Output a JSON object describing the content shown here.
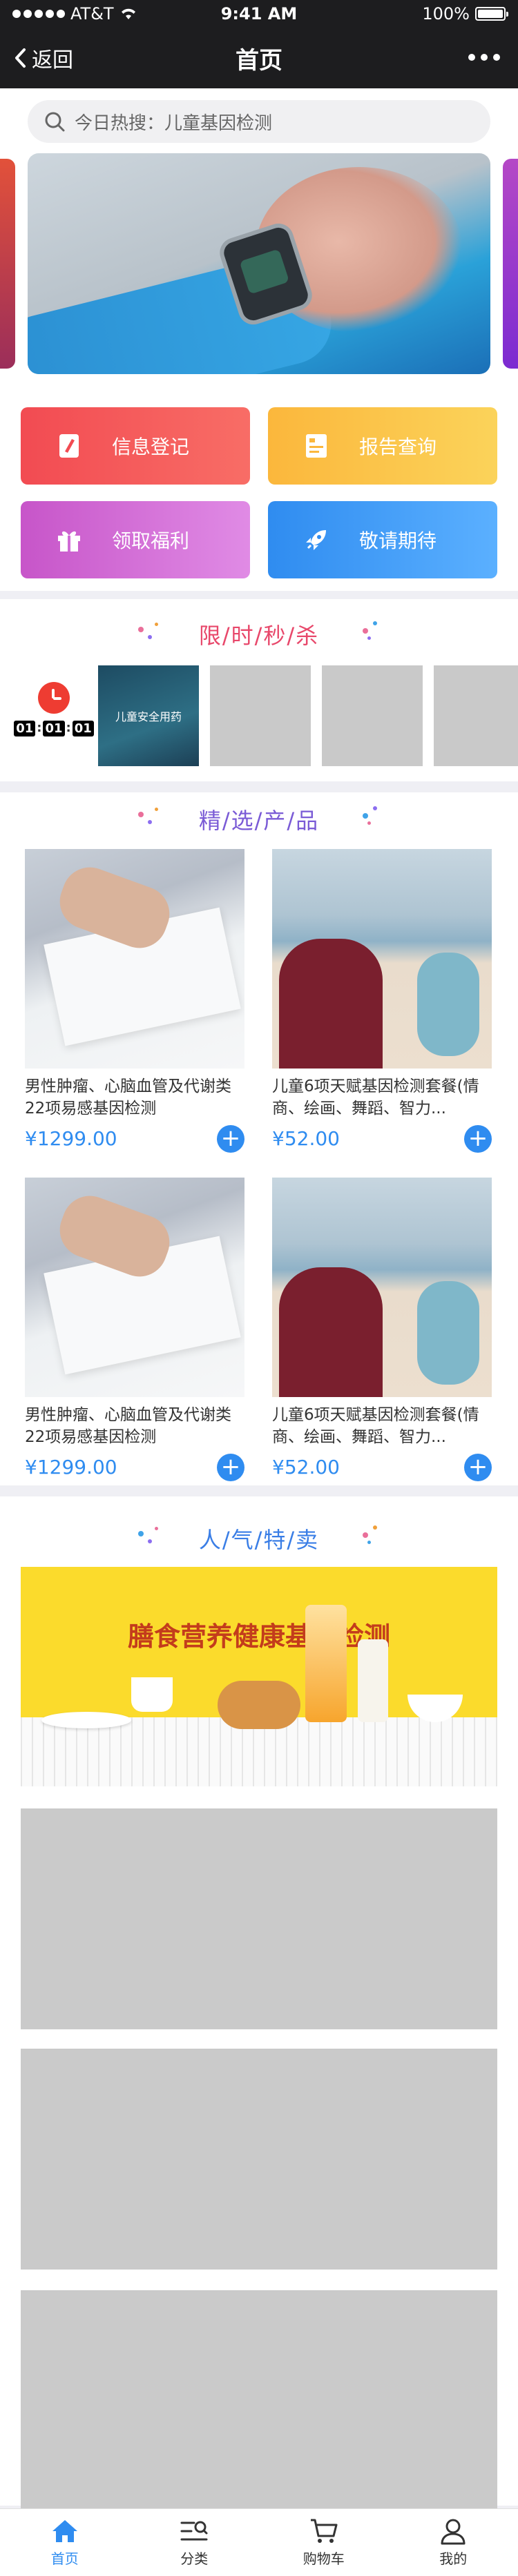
{
  "status_bar": {
    "carrier": "AT&T",
    "time": "9:41 AM",
    "battery": "100%"
  },
  "nav": {
    "back_label": "返回",
    "title": "首页"
  },
  "search": {
    "placeholder": "今日热搜：儿童基因检测"
  },
  "menu": [
    {
      "label": "信息登记",
      "icon": "pen-icon",
      "color": "#f24b52"
    },
    {
      "label": "报告查询",
      "icon": "report-icon",
      "color": "#fbb73c"
    },
    {
      "label": "领取福利",
      "icon": "gift-icon",
      "color": "#c755c9"
    },
    {
      "label": "敬请期待",
      "icon": "rocket-icon",
      "color": "#2f8cf0"
    }
  ],
  "flash_sale": {
    "title": "限/时/秒/杀",
    "countdown": [
      "01",
      "01",
      "01"
    ],
    "items": [
      {
        "label": "儿童安全用药"
      },
      {
        "label": ""
      },
      {
        "label": ""
      },
      {
        "label": ""
      }
    ]
  },
  "featured": {
    "title": "精/选/产/品",
    "products": [
      {
        "name": "男性肿瘤、心脑血管及代谢类22项易感基因检测",
        "price": "¥1299.00",
        "image": "writing-hand"
      },
      {
        "name": "儿童6项天赋基因检测套餐(情商、绘画、舞蹈、智力...",
        "price": "¥52.00",
        "image": "kids-beach"
      },
      {
        "name": "男性肿瘤、心脑血管及代谢类22项易感基因检测",
        "price": "¥1299.00",
        "image": "writing-hand"
      },
      {
        "name": "儿童6项天赋基因检测套餐(情商、绘画、舞蹈、智力...",
        "price": "¥52.00",
        "image": "kids-beach"
      }
    ]
  },
  "popular": {
    "title": "人/气/特/卖",
    "banner_text": "膳食营养健康基因检测"
  },
  "tabbar": [
    {
      "label": "首页",
      "icon": "home-icon",
      "active": true
    },
    {
      "label": "分类",
      "icon": "category-icon",
      "active": false
    },
    {
      "label": "购物车",
      "icon": "cart-icon",
      "active": false
    },
    {
      "label": "我的",
      "icon": "user-icon",
      "active": false
    }
  ],
  "colors": {
    "accent": "#2f8cf0",
    "flash_title": "#e8486b",
    "featured_title": "#7a5bd6",
    "popular_title": "#3a7ee6"
  }
}
